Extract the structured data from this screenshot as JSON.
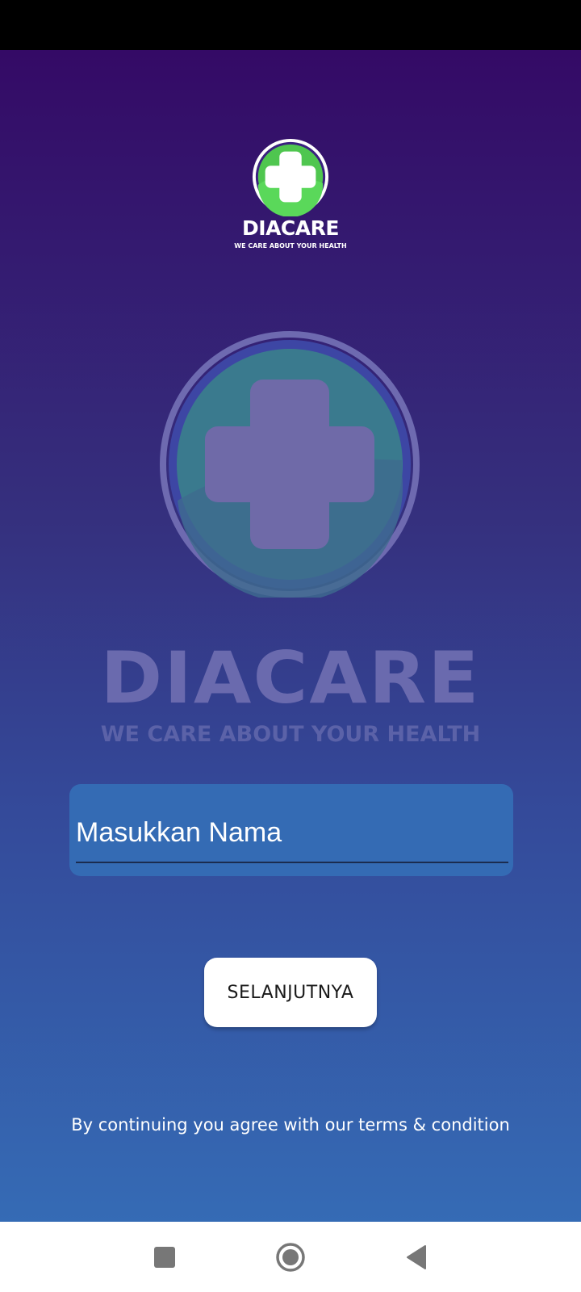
{
  "brand": {
    "name": "DIACARE",
    "tagline": "WE CARE ABOUT YOUR HEALTH"
  },
  "form": {
    "name_placeholder": "Masukkan Nama",
    "name_value": ""
  },
  "actions": {
    "next_label": "SELANJUTNYA"
  },
  "footer": {
    "terms": "By continuing you agree with our terms & condition"
  },
  "icons": {
    "logo": "medical-cross-icon",
    "nav_recents": "square-icon",
    "nav_home": "circle-icon",
    "nav_back": "triangle-back-icon"
  },
  "colors": {
    "gradient_top": "#340a66",
    "gradient_bottom": "#356bb5",
    "logo_green": "#5ed65e",
    "input_bg": "#346bb4",
    "button_bg": "#ffffff"
  }
}
